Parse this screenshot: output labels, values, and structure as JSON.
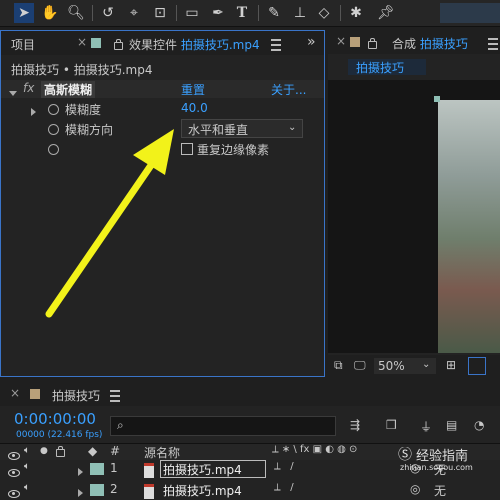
{
  "effects_panel": {
    "tab_project": "项目",
    "tab_effect_prefix": "效果控件",
    "tab_effect_file": "拍摄技巧.mp4",
    "breadcrumb": "拍摄技巧 • 拍摄技巧.mp4",
    "effect_name": "高斯模糊",
    "reset_label": "重置",
    "about_label": "关于...",
    "props": [
      {
        "label": "模糊度",
        "value": "40.0"
      },
      {
        "label": "模糊方向",
        "value": "水平和垂直"
      },
      {
        "label": "",
        "value": "重复边缘像素"
      }
    ]
  },
  "comp_panel": {
    "tab_prefix": "合成",
    "tab_name": "拍摄技巧",
    "subtab": "拍摄技巧",
    "zoom": "50%"
  },
  "timeline": {
    "tab_name": "拍摄技巧",
    "timecode": "0:00:00:00",
    "frames": "00000 (22.416 fps)",
    "search_placeholder": "",
    "col_number": "#",
    "col_source": "源名称",
    "layers": [
      {
        "index": "1",
        "name": "拍摄技巧.mp4",
        "parent": "无"
      },
      {
        "index": "2",
        "name": "拍摄技巧.mp4",
        "parent": "无"
      }
    ]
  },
  "watermark": {
    "text": "经验指南",
    "url": "zhinan.sogou.com"
  },
  "colors": {
    "accent": "#3aa0ff",
    "arrow": "#f2f21a",
    "timecode": "#3aa0ff",
    "layer_label": "#8fbfb5"
  },
  "icons": [
    "selection-tool-icon",
    "hand-tool-icon",
    "zoom-tool-icon",
    "rotate-tool-icon",
    "camera-orbit-icon",
    "pan-behind-icon",
    "rectangle-tool-icon",
    "pen-tool-icon",
    "type-tool-icon",
    "brush-tool-icon",
    "clone-stamp-icon",
    "eraser-tool-icon",
    "roto-brush-icon",
    "puppet-pin-icon"
  ]
}
